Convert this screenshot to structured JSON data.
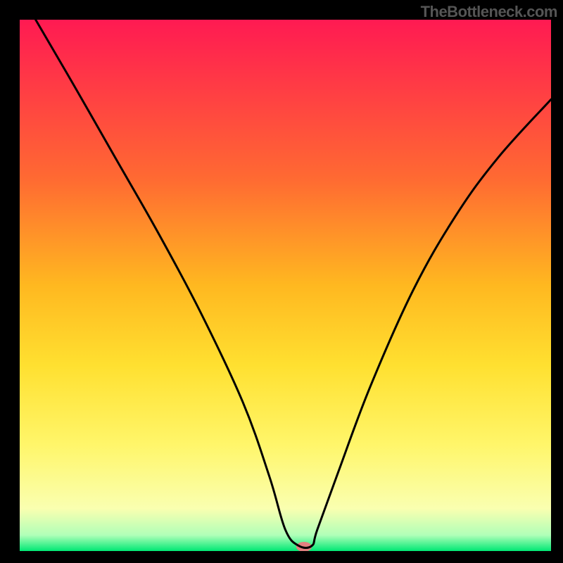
{
  "attribution": "TheBottleneck.com",
  "chart_data": {
    "type": "line",
    "title": "",
    "xlabel": "",
    "ylabel": "",
    "xlim": [
      0,
      100
    ],
    "ylim": [
      0,
      100
    ],
    "background_gradient": {
      "stops": [
        {
          "offset": 0,
          "color": "#ff1a52"
        },
        {
          "offset": 30,
          "color": "#ff6a32"
        },
        {
          "offset": 50,
          "color": "#ffb820"
        },
        {
          "offset": 65,
          "color": "#ffe030"
        },
        {
          "offset": 80,
          "color": "#fff66a"
        },
        {
          "offset": 92,
          "color": "#faffb0"
        },
        {
          "offset": 97,
          "color": "#b0ffb8"
        },
        {
          "offset": 100,
          "color": "#00e874"
        }
      ]
    },
    "series": [
      {
        "name": "bottleneck-curve",
        "x": [
          3,
          10,
          18,
          26,
          34,
          42,
          47,
          50,
          52.5,
          55,
          56,
          60,
          66,
          74,
          82,
          90,
          100
        ],
        "y": [
          100,
          88,
          74,
          60,
          45,
          28,
          14,
          4,
          1,
          1,
          4,
          15,
          31,
          49,
          63,
          74,
          85
        ]
      }
    ],
    "annotations": [
      {
        "name": "min-marker",
        "x": 53.5,
        "y": 0.8,
        "color": "#e28080"
      }
    ]
  }
}
